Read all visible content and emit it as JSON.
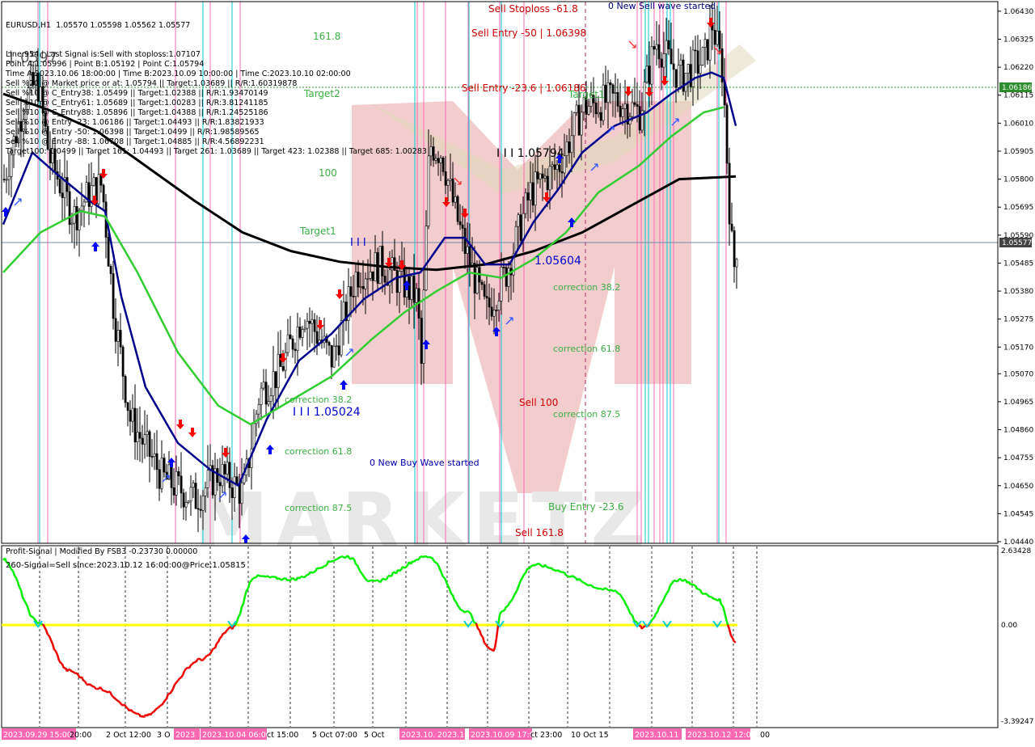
{
  "window": {
    "title": "EURUSD,H1  1.05570 1.05598 1.05562 1.05577"
  },
  "info_lines": [
    "Line:954 | Last Signal is:Sell with stoploss:1.07107",
    "Point A:1.05996 | Point B:1.05192 | Point C:1.05794",
    "Time A:2023.10.06 18:00:00 | Time B:2023.10.09 10:00:00 | Time C:2023.10.10 02:00:00",
    "Sell %20 @ Market price or at: 1.05794 || Target:1.03689 || R/R:1.60319878",
    "Sell %10 @ C_Entry38: 1.05499 || Target:1.02388 || R/R:1.93470149",
    "Sell %10 @ C_Entry61: 1.05689 || Target:1.00283 || R/R:3.81241185",
    "Sell %10 @ C_Entry88: 1.05896 || Target:1.04388 || R/R:1.24525186",
    "Sell %10 @ Entry -23: 1.06186 || Target:1.04493 || R/R:1.83821933",
    "Sell %10 @ Entry -50: 1.06398 || Target:1.0499 || R/R:1.98589565",
    "Sell %10 @ Entry -88: 1.06708 || Target:1.04885 || R/R:4.56892231",
    "Target100: 1.0499 || Target 161: 1.04493 || Target 261: 1.03689 || Target 423: 1.02388 || Target 685: 1.00283"
  ],
  "colors": {
    "background": "#ffffff",
    "candle": "#000000",
    "ma_black": "#000000",
    "ma_blue": "#00008b",
    "ma_green": "#32cd32",
    "buy_arrow": "#0000ff",
    "sell_arrow": "#ff0000",
    "pink_line": "#ff69b4",
    "cyan_line": "#00ced1",
    "osc_up": "#00ee00",
    "osc_down": "#ee0000",
    "osc_zero": "#ffff00",
    "watermark": "#c0392b",
    "level_text_green": "#2e8b57",
    "level_text_red": "#cc0000",
    "level_text_blue": "#0000aa"
  },
  "price_axis": {
    "labels": [
      "1.06430",
      "1.06325",
      "1.06220",
      "1.06115",
      "1.06010",
      "1.05905",
      "1.05800",
      "1.05695",
      "1.05590",
      "1.05485",
      "1.05380",
      "1.05275",
      "1.05170",
      "1.05070",
      "1.04965",
      "1.04860",
      "1.04755",
      "1.04650",
      "1.04545",
      "1.04440"
    ],
    "current_price": "1.05577",
    "marker_price": "1.06186"
  },
  "osc_axis": {
    "top": "2.63428",
    "zero": "0.00",
    "bottom": "-3.39247"
  },
  "time_axis": [
    {
      "text": "2023.09.29 15:00",
      "hl": true
    },
    {
      "text": "20:00",
      "hl": false
    },
    {
      "text": "2 Oct 12:00",
      "hl": false
    },
    {
      "text": "3 O",
      "hl": false
    },
    {
      "text": "2023",
      "hl": true
    },
    {
      "text": "2023.10.04 06:00",
      "hl": true
    },
    {
      "text": "ct 15:00",
      "hl": false
    },
    {
      "text": "5 Oct 07:00",
      "hl": false
    },
    {
      "text": "5 Oct",
      "hl": false
    },
    {
      "text": "2023.10.06",
      "hl": true
    },
    {
      "text": "2023.10",
      "hl": true
    },
    {
      "text": "2023.10.09 17:00",
      "hl": true
    },
    {
      "text": "ct 23:00",
      "hl": false
    },
    {
      "text": "10 Oct 15",
      "hl": false
    },
    {
      "text": "2023.10.11",
      "hl": true
    },
    {
      "text": "2023.10.12 12:00",
      "hl": true
    },
    {
      "text": "00",
      "hl": false
    }
  ],
  "chart_labels": {
    "sell_stoploss": "Sell Stoploss -61.8",
    "new_sell_wave": "0 New Sell wave started",
    "sell_entry_50": "Sell Entry -50 | 1.06398",
    "sell_entry_236": "Sell Entry -23.6 | 1.06186",
    "target2": "Target2",
    "target1_right": "Target1",
    "level_1618": "161.8",
    "level_100": "100",
    "target1_left": "Target1",
    "wave_top": "I I I 1.05794",
    "wave_mid": "I I I",
    "wave_low_c": "1.05604",
    "wave_low": "I I I 1.05024",
    "corr_382_r": "correction 38.2",
    "corr_618_r": "correction 61.8",
    "corr_875_r": "correction 87.5",
    "corr_382_l": "correction 38.2",
    "corr_618_l": "correction 61.8",
    "corr_875_l": "correction 87.5",
    "sell_100": "Sell 100",
    "new_buy_wave": "0 New Buy Wave started",
    "buy_entry": "Buy Entry -23.6",
    "sell_1618": "Sell 161.8",
    "big_price": "1.0597"
  },
  "osc_labels": {
    "title": "Profit-Signal | Modified By FSB3 -0.23730 0.00000",
    "signal": "260-Signal=Sell since:2023.10.12 16:00:00@Price:1.05815"
  },
  "chart_data": {
    "type": "candlestick",
    "symbol": "EURUSD",
    "timeframe": "H1",
    "ylim": [
      1.0444,
      1.0646
    ],
    "osc_ylim": [
      -3.39247,
      2.63428
    ],
    "key_levels": {
      "point_a": 1.05996,
      "point_b": 1.05192,
      "point_c": 1.05794,
      "stoploss": 1.07107,
      "sell_entry_236": 1.06186,
      "sell_entry_50": 1.06398,
      "current": 1.05577
    },
    "ma200_anchor_prices": [
      1.0612,
      1.0606,
      1.0598,
      1.0585,
      1.0572,
      1.056,
      1.0553,
      1.0549,
      1.0547,
      1.0546,
      1.0548,
      1.0553,
      1.056,
      1.057,
      1.058,
      1.0581
    ],
    "osc_anchor_values": [
      2.3,
      0.1,
      -1.6,
      -2.2,
      -3.2,
      -1.2,
      -0.1,
      1.7,
      1.6,
      2.4,
      1.5,
      2.4,
      0.5,
      -0.9,
      0.5,
      2.1,
      1.2,
      -0.1,
      1.6,
      0.9,
      -0.6
    ]
  }
}
